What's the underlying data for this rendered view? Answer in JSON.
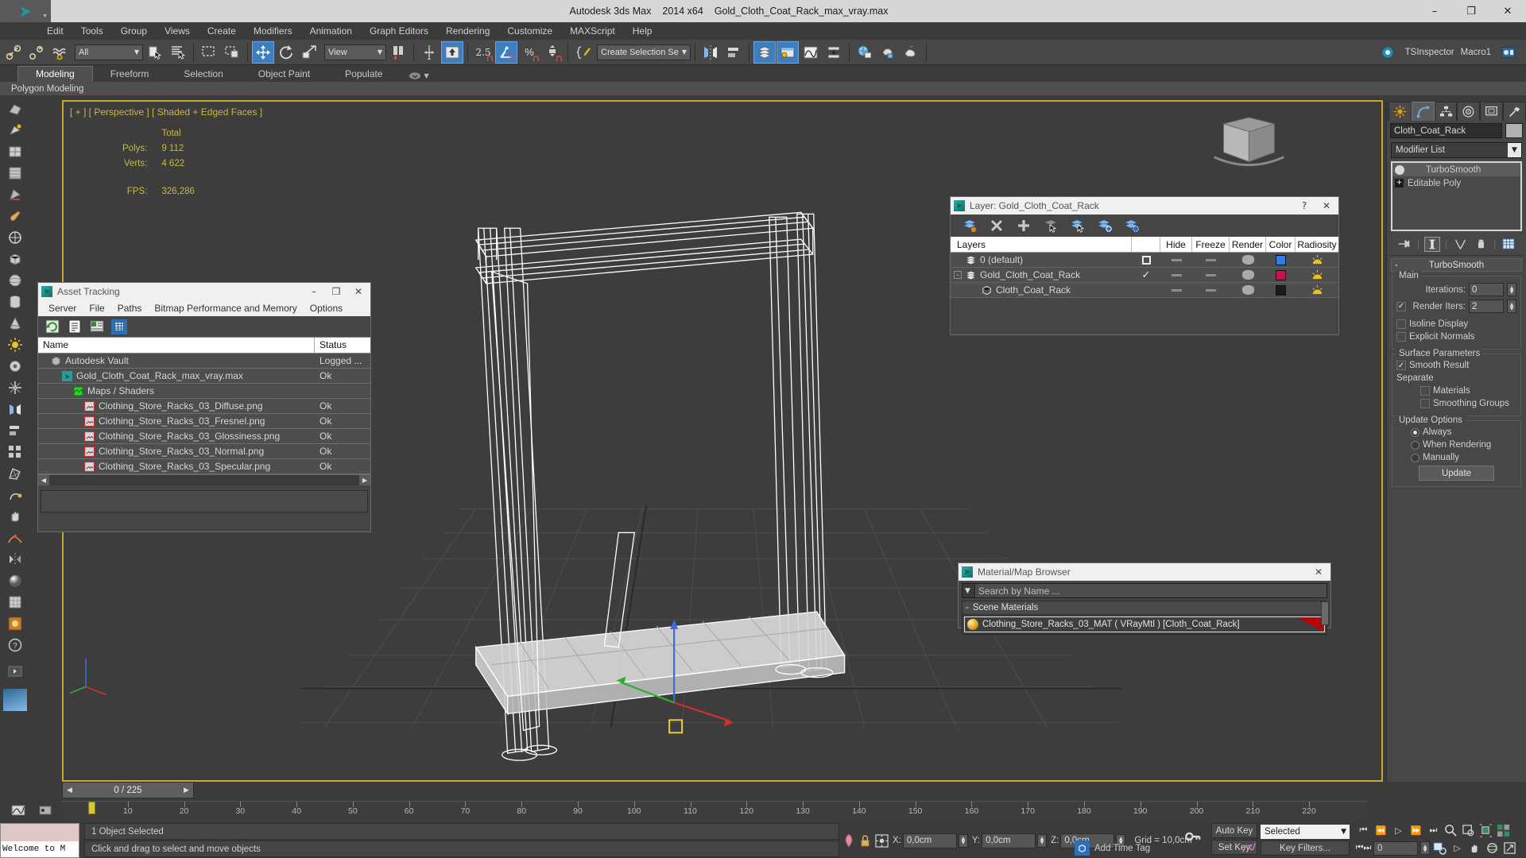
{
  "titlebar": {
    "app_name": "Autodesk 3ds Max",
    "version": "2014 x64",
    "document": "Gold_Cloth_Coat_Rack_max_vray.max",
    "minimize": "–",
    "maximize": "❐",
    "close": "✕"
  },
  "menubar": {
    "items": [
      "Edit",
      "Tools",
      "Group",
      "Views",
      "Create",
      "Modifiers",
      "Animation",
      "Graph Editors",
      "Rendering",
      "Customize",
      "MAXScript",
      "Help"
    ]
  },
  "toolbar": {
    "selection_filter": "All",
    "reference_coord": "View",
    "named_selection_set": "Create Selection Se",
    "angle_snap_value": "2.5",
    "tsinspector": "TSInspector",
    "macro": "Macro1"
  },
  "ribbon": {
    "tabs": [
      "Modeling",
      "Freeform",
      "Selection",
      "Object Paint",
      "Populate"
    ],
    "active_tab": "Modeling",
    "subtitle": "Polygon Modeling"
  },
  "viewport": {
    "label": "[ + ] [ Perspective ] [ Shaded + Edged Faces ]",
    "stats": {
      "header": "Total",
      "polys_label": "Polys:",
      "polys_value": "9 112",
      "verts_label": "Verts:",
      "verts_value": "4 622",
      "fps_label": "FPS:",
      "fps_value": "326,286"
    },
    "border_color": "#c8a830",
    "stat_color": "#c8b840"
  },
  "asset_tracking": {
    "title": "Asset Tracking",
    "menu": [
      "Server",
      "File",
      "Paths",
      "Bitmap Performance and Memory",
      "Options"
    ],
    "columns": [
      "Name",
      "Status"
    ],
    "rows": [
      {
        "name": "Autodesk Vault",
        "status": "Logged ...",
        "indent": 1,
        "icon": "vault-icon"
      },
      {
        "name": "Gold_Cloth_Coat_Rack_max_vray.max",
        "status": "Ok",
        "indent": 2,
        "icon": "max-file-icon"
      },
      {
        "name": "Maps / Shaders",
        "status": "",
        "indent": 3,
        "icon": "maps-icon"
      },
      {
        "name": "Clothing_Store_Racks_03_Diffuse.png",
        "status": "Ok",
        "indent": 4,
        "icon": "bitmap-icon"
      },
      {
        "name": "Clothing_Store_Racks_03_Fresnel.png",
        "status": "Ok",
        "indent": 4,
        "icon": "bitmap-icon"
      },
      {
        "name": "Clothing_Store_Racks_03_Glossiness.png",
        "status": "Ok",
        "indent": 4,
        "icon": "bitmap-icon"
      },
      {
        "name": "Clothing_Store_Racks_03_Normal.png",
        "status": "Ok",
        "indent": 4,
        "icon": "bitmap-icon"
      },
      {
        "name": "Clothing_Store_Racks_03_Specular.png",
        "status": "Ok",
        "indent": 4,
        "icon": "bitmap-icon"
      }
    ]
  },
  "layer_dialog": {
    "title": "Layer: Gold_Cloth_Coat_Rack",
    "help": "?",
    "close": "✕",
    "columns": [
      "Layers",
      "",
      "Hide",
      "Freeze",
      "Render",
      "Color",
      "Radiosity"
    ],
    "rows": [
      {
        "name": "0 (default)",
        "indent": 1,
        "current": "box",
        "hide": "—",
        "freeze": "—",
        "render": "teapot",
        "color": "#2f7fe0",
        "radiosity": "radiosity-icon",
        "expander": ""
      },
      {
        "name": "Gold_Cloth_Coat_Rack",
        "indent": 1,
        "current": "check",
        "hide": "—",
        "freeze": "—",
        "render": "teapot",
        "color": "#c8144b",
        "radiosity": "radiosity-icon",
        "expander": "-"
      },
      {
        "name": "Cloth_Coat_Rack",
        "indent": 2,
        "current": "",
        "hide": "—",
        "freeze": "—",
        "render": "teapot",
        "color": "#1a1a1a",
        "radiosity": "radiosity-icon",
        "expander": ""
      }
    ]
  },
  "material_browser": {
    "title": "Material/Map Browser",
    "close": "✕",
    "search_placeholder": "Search by Name ...",
    "group_label": "Scene Materials",
    "group_toggle": "-",
    "material": "Clothing_Store_Racks_03_MAT  ( VRayMtl )  [Cloth_Coat_Rack]"
  },
  "command_panel": {
    "object_name": "Cloth_Coat_Rack",
    "modifier_list": "Modifier List",
    "stack": [
      "TurboSmooth",
      "Editable Poly"
    ],
    "selected_stack_item": "TurboSmooth",
    "rollout": {
      "title": "TurboSmooth",
      "minus": "-",
      "main_group": "Main",
      "iterations_label": "Iterations:",
      "iterations_value": "0",
      "render_iters_label": "Render Iters:",
      "render_iters_value": "2",
      "render_iters_checked": true,
      "isoline_display": "Isoline Display",
      "explicit_normals": "Explicit Normals",
      "surface_group": "Surface Parameters",
      "smooth_result": "Smooth Result",
      "smooth_result_checked": true,
      "separate_label": "Separate",
      "separate_materials": "Materials",
      "separate_smoothing_groups": "Smoothing Groups",
      "update_group": "Update Options",
      "update_always": "Always",
      "update_when_rendering": "When Rendering",
      "update_manually": "Manually",
      "update_selected": "Always",
      "update_button": "Update"
    }
  },
  "timeline": {
    "slider_value": "0 / 225",
    "prev_arrow": "◀",
    "next_arrow": "▶",
    "ruler_labels": [
      "10",
      "20",
      "30",
      "40",
      "50",
      "60",
      "70",
      "80",
      "90",
      "100",
      "110",
      "120",
      "130",
      "140",
      "150",
      "160",
      "170",
      "180",
      "190",
      "200",
      "210",
      "220"
    ]
  },
  "statusbar": {
    "mini_listener_text": "Welcome to M",
    "selection_status": "1 Object Selected",
    "prompt": "Click and drag to select and move objects",
    "x_label": "X:",
    "x_value": "0,0cm",
    "y_label": "Y:",
    "y_value": "0,0cm",
    "z_label": "Z:",
    "z_value": "0,0cm",
    "grid_text": "Grid = 10,0cm",
    "add_time_tag": "Add Time Tag",
    "auto_key": "Auto Key",
    "set_key": "Set Key",
    "key_mode_selected": "Selected",
    "key_filters": "Key Filters...",
    "frame_value": "0"
  }
}
